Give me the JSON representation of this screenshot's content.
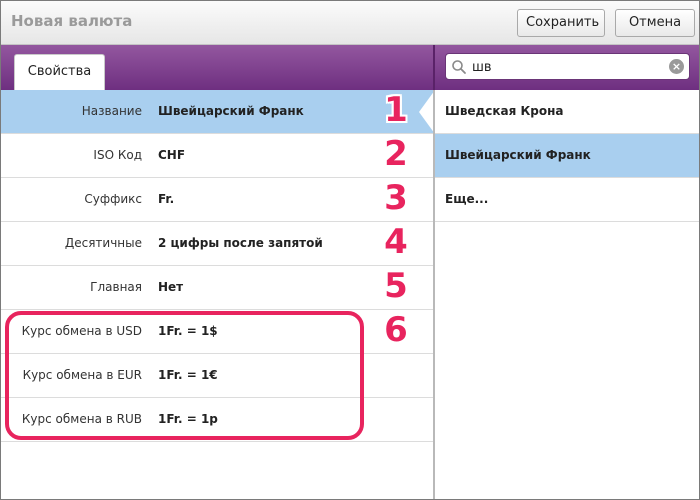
{
  "window": {
    "title": "Новая валюта",
    "save_label": "Сохранить",
    "cancel_label": "Отмена"
  },
  "tabs": [
    {
      "label": "Свойства"
    }
  ],
  "search": {
    "value": "шв",
    "placeholder": ""
  },
  "form": {
    "rows": [
      {
        "label": "Название",
        "value": "Швейцарский Франк",
        "marker": "1"
      },
      {
        "label": "ISO Код",
        "value": "CHF",
        "marker": "2"
      },
      {
        "label": "Суффикс",
        "value": "Fr.",
        "marker": "3"
      },
      {
        "label": "Десятичные",
        "value": "2 цифры после запятой",
        "marker": "4"
      },
      {
        "label": "Главная",
        "value": "Нет",
        "marker": "5"
      },
      {
        "label": "Курс обмена в USD",
        "value": "1Fr. = 1$",
        "marker": "6"
      },
      {
        "label": "Курс обмена в EUR",
        "value": "1Fr. = 1€"
      },
      {
        "label": "Курс обмена в RUB",
        "value": "1Fr. = 1р"
      }
    ]
  },
  "results": {
    "items": [
      {
        "label": "Шведская Крона"
      },
      {
        "label": "Швейцарский Франк"
      },
      {
        "label": "Еще..."
      }
    ]
  },
  "colors": {
    "accent": "#7b3a8c",
    "selection": "#a9cfef",
    "annotation": "#e8245e"
  }
}
